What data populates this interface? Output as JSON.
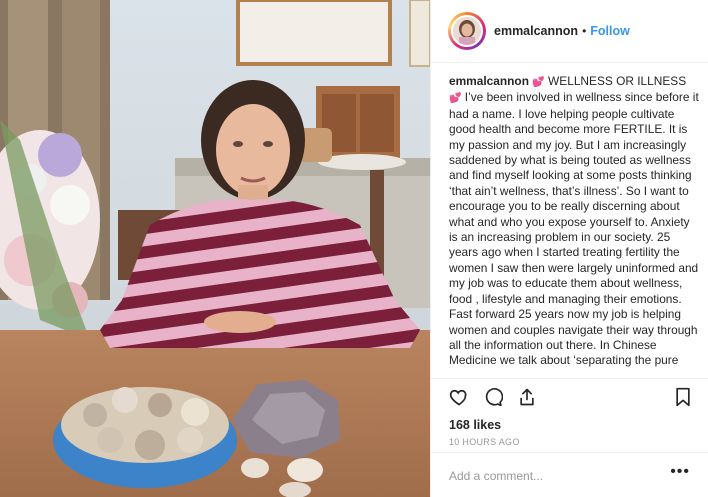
{
  "header": {
    "username": "emmalcannon",
    "separator": "•",
    "follow_label": "Follow"
  },
  "caption": {
    "username": "emmalcannon",
    "emoji_1": "💕",
    "heading": "WELLNESS OR ILLNESS",
    "emoji_2": "💕",
    "body": "I’ve been involved in wellness since before it had a name. I love helping people cultivate good health and become more FERTILE. It is my passion and my joy. But I am increasingly saddened by what is being touted as wellness and find myself looking at some posts thinking ‘that ain’t wellness, that’s illness’. So I want to encourage you to be really discerning about what and who you expose yourself to. Anxiety is an increasing problem in our society. 25 years ago when I started treating fertility the women I saw then were largely uninformed and my job was to educate them about wellness, food , lifestyle and managing their emotions. Fast forward 25 years now my job is helping women and couples navigate their way through all the information out there. In Chinese Medicine we talk about ‘separating the pure from"
  },
  "actions": {
    "icons": [
      "heart-icon",
      "comment-icon",
      "share-icon",
      "bookmark-icon"
    ],
    "likes": "168 likes",
    "time": "10 HOURS AGO"
  },
  "comment": {
    "placeholder": "Add a comment...",
    "more": "•••"
  },
  "colors": {
    "link_blue": "#3897f0",
    "text": "#262626",
    "muted": "#999999",
    "divider": "#efefef"
  }
}
